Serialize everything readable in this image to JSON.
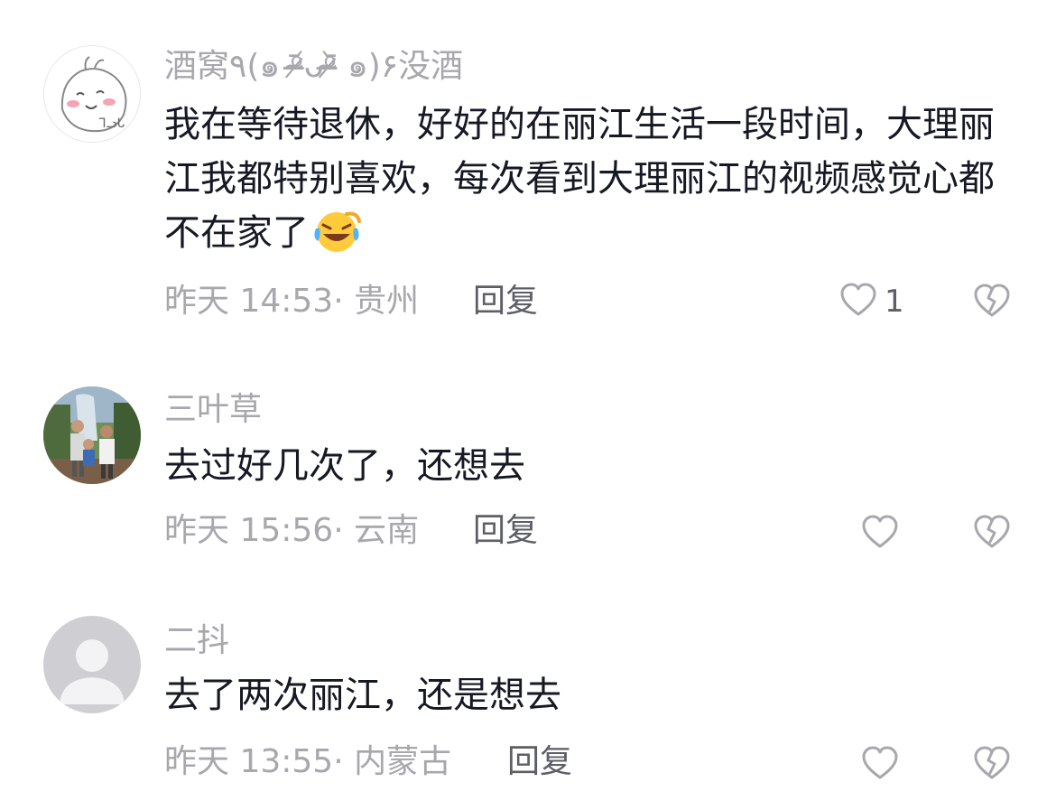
{
  "comments": [
    {
      "username": "酒窝٩(๑ ᵒ̴̶̷᷄ᴗᵒ̴̶̷᷅ ๑)۶没酒",
      "text": "我在等待退休，好好的在丽江生活一段时间，大理丽江我都特别喜欢，每次看到大理丽江的视频感觉心都不在家了",
      "emoji": "laughing-crying-emoji",
      "time": "昨天 14:53",
      "location": "贵州",
      "reply_label": "回复",
      "like_count": "1",
      "avatar": "cartoon-face-avatar"
    },
    {
      "username": "三叶草",
      "text": "去过好几次了，还想去",
      "time": "昨天 15:56",
      "location": "云南",
      "reply_label": "回复",
      "like_count": "",
      "avatar": "family-photo-avatar"
    },
    {
      "username": "二抖",
      "text": "去了两次丽江，还是想去",
      "time": "昨天 13:55",
      "location": "内蒙古",
      "reply_label": "回复",
      "like_count": "",
      "avatar": "default-avatar"
    }
  ],
  "colors": {
    "username": "#a7a7ad",
    "text": "#161823",
    "meta": "#a7a7ad",
    "reply": "#5d5e66",
    "icon": "#a7a7ad"
  }
}
